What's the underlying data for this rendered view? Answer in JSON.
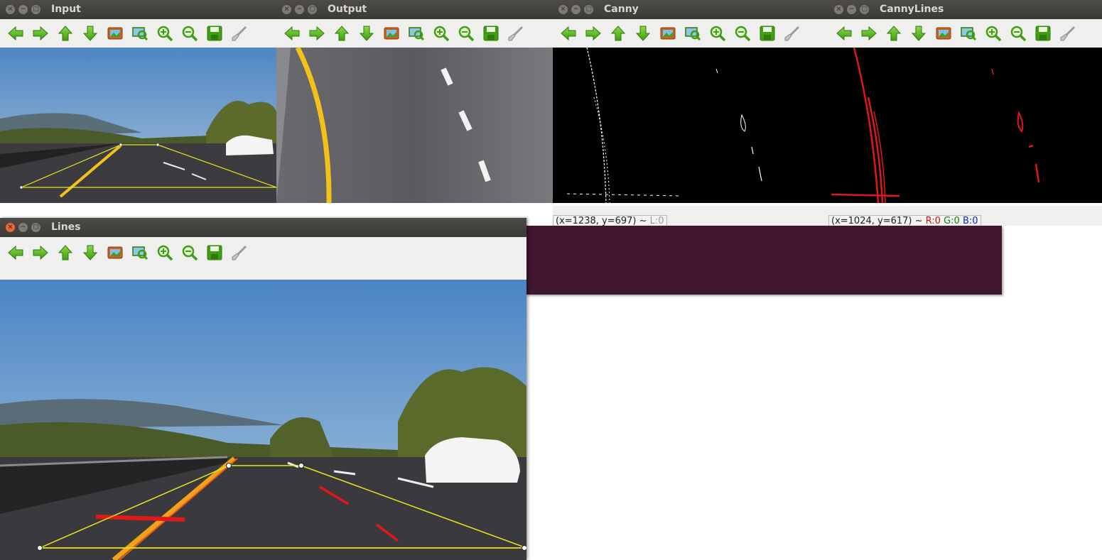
{
  "windows": {
    "input": {
      "title": "Input",
      "status": ""
    },
    "output": {
      "title": "Output",
      "status": ""
    },
    "canny": {
      "title": "Canny",
      "status_coords": "(x=1238, y=697) ~",
      "status_l": "L:0"
    },
    "cannylines": {
      "title": "CannyLines",
      "status_coords": "(x=1024, y=617) ~",
      "status_r": "R:0",
      "status_g": "G:0",
      "status_b": "B:0"
    },
    "lines": {
      "title": "Lines"
    }
  },
  "toolbar_icons": [
    "arrow-left-icon",
    "arrow-right-icon",
    "arrow-up-icon",
    "arrow-down-icon",
    "image-icon",
    "zoom-fit-icon",
    "zoom-in-icon",
    "zoom-out-icon",
    "save-icon",
    "properties-icon"
  ],
  "colors": {
    "titlebar": "#3b3a35",
    "toolbar": "#efefee",
    "desktop_plum": "#3f1530",
    "close_active": "#e8663b",
    "arrow_green": "#4caf1a",
    "roi_yellow": "#e8e81a",
    "lane_red": "#e01818"
  }
}
